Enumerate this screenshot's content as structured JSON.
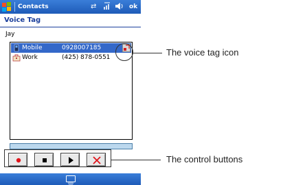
{
  "app": {
    "title": "Contacts",
    "ok_label": "ok",
    "icons": [
      "windows-start-icon",
      "sync-icon",
      "signal-icon",
      "speaker-icon"
    ]
  },
  "page": {
    "title": "Voice Tag"
  },
  "contact": {
    "name": "Jay"
  },
  "entries": [
    {
      "label": "Mobile",
      "number": "0928007185",
      "icon": "mobile-phone-icon",
      "selected": true,
      "voice_tag_icon": "voice-tag-icon"
    },
    {
      "label": "Work",
      "number": "(425) 878-0551",
      "icon": "work-phone-icon",
      "selected": false
    }
  ],
  "controls": [
    {
      "name": "record-button",
      "icon": "record-icon",
      "color": "#e0141b"
    },
    {
      "name": "stop-button",
      "icon": "stop-icon",
      "color": "#000000"
    },
    {
      "name": "play-button",
      "icon": "play-icon",
      "color": "#000000"
    },
    {
      "name": "delete-button",
      "icon": "delete-icon",
      "color": "#e0141b"
    }
  ],
  "annotations": {
    "voice_tag": "The voice tag icon",
    "controls": "The control buttons"
  },
  "colors": {
    "titlebar": "#2a6bd0",
    "selection": "#3468c9",
    "heading": "#1b3f9c"
  }
}
